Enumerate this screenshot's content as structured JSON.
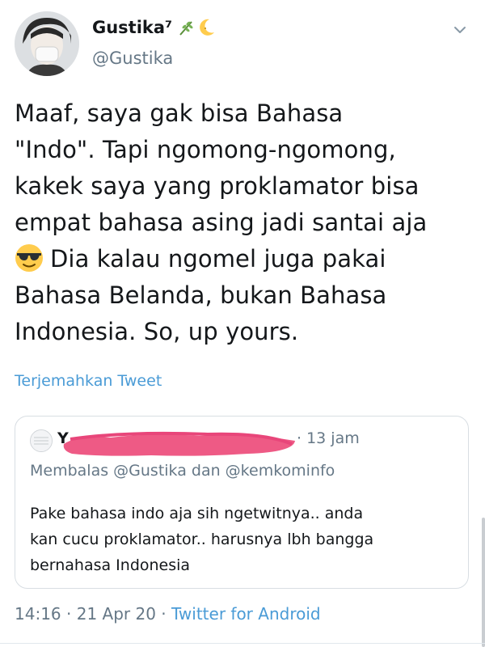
{
  "author": {
    "display_name": "Gustika⁷",
    "handle": "@Gustika",
    "badges": [
      "herb-icon",
      "crescent-moon-icon"
    ]
  },
  "tweet": {
    "lines": [
      "Maaf, saya gak bisa Bahasa",
      "\"Indo\". Tapi ngomong-ngomong,",
      "kakek saya yang proklamator bisa",
      "empat bahasa asing jadi santai aja",
      "Dia kalau ngomel juga pakai",
      "Bahasa Belanda, bukan Bahasa",
      "Indonesia. So, up yours."
    ],
    "emoji": "smiling-face-with-sunglasses-icon",
    "translate_label": "Terjemahkan Tweet"
  },
  "quoted": {
    "name_visible": "Y",
    "time": "13 jam",
    "reply_to": "Membalas @Gustika dan @kemkominfo",
    "lines": [
      "Pake bahasa indo aja sih ngetwitnya.. anda",
      "kan cucu proklamator.. harusnya lbh bangga",
      "bernahasa Indonesia"
    ]
  },
  "meta": {
    "time": "14:16",
    "date": "21 Apr 20",
    "source": "Twitter for Android",
    "separator": " · "
  },
  "colors": {
    "text": "#14171a",
    "muted": "#657786",
    "link": "#4a9bd6",
    "border": "#d8dee3",
    "redaction": "#ee5a85"
  }
}
